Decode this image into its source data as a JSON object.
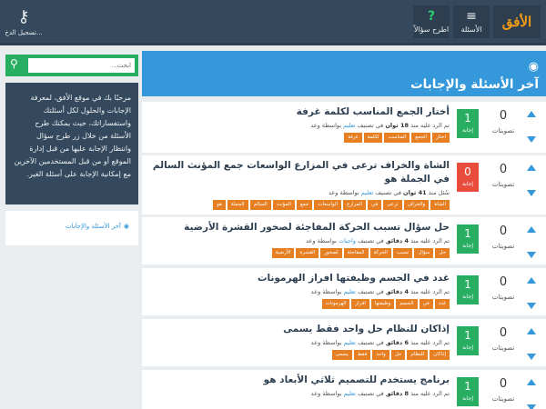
{
  "header": {
    "logo": "الأفق",
    "nav_questions": "الأسئلة",
    "nav_ask": "اطرح سؤالاً",
    "nav_login": "تسجيل الدخ..."
  },
  "search": {
    "placeholder": "ابحث..."
  },
  "sidebar": {
    "welcome": "مرحبًا بك في موقع الأفق، لمعرفة الإجابات والحلول لكل أسئلتك واستفساراتك، حيث يمكنك طرح الأسئلة من خلال زر طرح سؤال وانتظار الإجابة عليها من قبل إدارة الموقع أو من قبل المستخدمين الآخرين مع إمكانية الإجابة على أسئلة الغير.",
    "latest_link": "آخر الأسئلة والإجابات"
  },
  "main": {
    "title": "آخر الأسئلة والإجابات",
    "votes_label": "تصويتات",
    "answer_label": "إجابة",
    "questions": [
      {
        "title": "أختار الجمع المناسب لكلمة غرفة",
        "answers": "1",
        "votes": "0",
        "answered": true,
        "meta_prefix": "تم الرد عليه منذ",
        "meta_time": "18 ثوان",
        "meta_mid": "في تصنيف",
        "meta_cat": "تعليم",
        "meta_suffix": "بواسطة وعد",
        "tags": [
          "اختار",
          "الجمع",
          "المناسب",
          "لكلمة",
          "غرفة"
        ]
      },
      {
        "title": "الشاة والخراف ترعى في المزارع الواسعات جمع المؤنث السالم في الجملة هو",
        "answers": "0",
        "votes": "0",
        "answered": false,
        "meta_prefix": "سُئل منذ",
        "meta_time": "41 ثوان",
        "meta_mid": "في تصنيف",
        "meta_cat": "تعليم",
        "meta_suffix": "بواسطة وعد",
        "tags": [
          "الشاة",
          "والخراف",
          "ترعى",
          "في",
          "المزارع",
          "الواسعات",
          "جمع",
          "المؤنث",
          "السالم",
          "الجملة",
          "هو"
        ]
      },
      {
        "title": "حل سؤال تسبب الحركة المفاجئة لصخور القشرة الأرضية",
        "answers": "1",
        "votes": "0",
        "answered": true,
        "meta_prefix": "تم الرد عليه منذ",
        "meta_time": "4 دقائق",
        "meta_mid": "في تصنيف",
        "meta_cat": "واجبات",
        "meta_suffix": "بواسطة وعد",
        "tags": [
          "حل",
          "سؤال",
          "تسبب",
          "الحركة",
          "المفاجئة",
          "لصخور",
          "القشرة",
          "الأرضية"
        ]
      },
      {
        "title": "غدد في الجسم وظيفتها افراز الهرمونات",
        "answers": "1",
        "votes": "0",
        "answered": true,
        "meta_prefix": "تم الرد عليه منذ",
        "meta_time": "4 دقائق",
        "meta_mid": "في تصنيف",
        "meta_cat": "تعليم",
        "meta_suffix": "بواسطة وعد",
        "tags": [
          "غدد",
          "في",
          "الجسم",
          "وظيفتها",
          "افراز",
          "الهرمونات"
        ]
      },
      {
        "title": "إذاكان للنظام حل واحد فقط يسمى",
        "answers": "1",
        "votes": "0",
        "answered": true,
        "meta_prefix": "تم الرد عليه منذ",
        "meta_time": "6 دقائق",
        "meta_mid": "في تصنيف",
        "meta_cat": "تعليم",
        "meta_suffix": "بواسطة وعد",
        "tags": [
          "إذاكان",
          "للنظام",
          "حل",
          "واحد",
          "فقط",
          "يسمى"
        ]
      },
      {
        "title": "برنامج يستخدم للتصميم ثلاثي الأبعاد هو",
        "answers": "1",
        "votes": "0",
        "answered": true,
        "meta_prefix": "تم الرد عليه منذ",
        "meta_time": "8 دقائق",
        "meta_mid": "في تصنيف",
        "meta_cat": "تعليم",
        "meta_suffix": "بواسطة وعد",
        "tags": []
      }
    ]
  }
}
